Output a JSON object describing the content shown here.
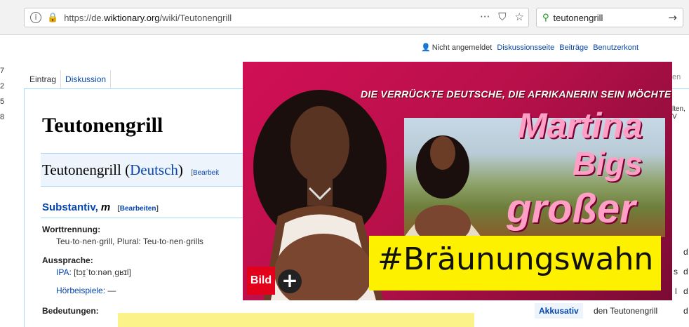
{
  "browser": {
    "url_prefix": "https://de.",
    "url_domain": "wiktionary.org",
    "url_path": "/wiki/Teutonengrill",
    "search_query": "teutonengrill",
    "info_icon": "i",
    "lock_icon": "🔒",
    "more_icon": "···",
    "pocket_icon": "⛉",
    "star_icon": "☆",
    "search_icon": "⚲",
    "arrow_icon": "→"
  },
  "personal": {
    "user_icon": "👤",
    "not_logged_in": "Nicht angemeldet",
    "talk": "Diskussionsseite",
    "contributions": "Beiträge",
    "account": "Benutzerkont"
  },
  "left_edge": [
    "7",
    "2",
    "5",
    "8"
  ],
  "tabs": {
    "entry": "Eintrag",
    "discussion": "Diskussion"
  },
  "article": {
    "title": "Teutonengrill",
    "h2_word": "Teutonengrill",
    "h2_lang": "Deutsch",
    "h2_edit": "Bearbeit",
    "pos": "Substantiv,",
    "gender": "m",
    "pos_edit": "Bearbeiten",
    "hyphenation_label": "Worttrennung:",
    "hyphenation_value": "Teu·to·nen·grill, Plural: Teu·to·nen·grills",
    "pron_label": "Aussprache:",
    "ipa_label": "IPA:",
    "ipa_value": "[tɔɪ̯ˈtoːnənˌɡʁɪl]",
    "audio_label": "Hörbeispiele:",
    "audio_value": "—",
    "meanings_label": "Bedeutungen:"
  },
  "right_side": {
    "search_frag": "en",
    "snippet": "lten, V"
  },
  "table": {
    "row_d": [
      "d",
      "d",
      "d"
    ],
    "row_s": "s",
    "row_l": "l",
    "acc_label": "Akkusativ",
    "acc_value": "den Teutonengrill",
    "acc_d": "d"
  },
  "ad": {
    "headline": "DIE VERRÜCKTE DEUTSCHE, DIE AFRIKANERIN SEIN MÖCHTE",
    "name_line1": "Martina",
    "name_line2": "Bigs",
    "name_line3": "großer",
    "hashtag": "#Bräunungswahn",
    "logo_text": "Bild",
    "plus_icon": "+"
  }
}
